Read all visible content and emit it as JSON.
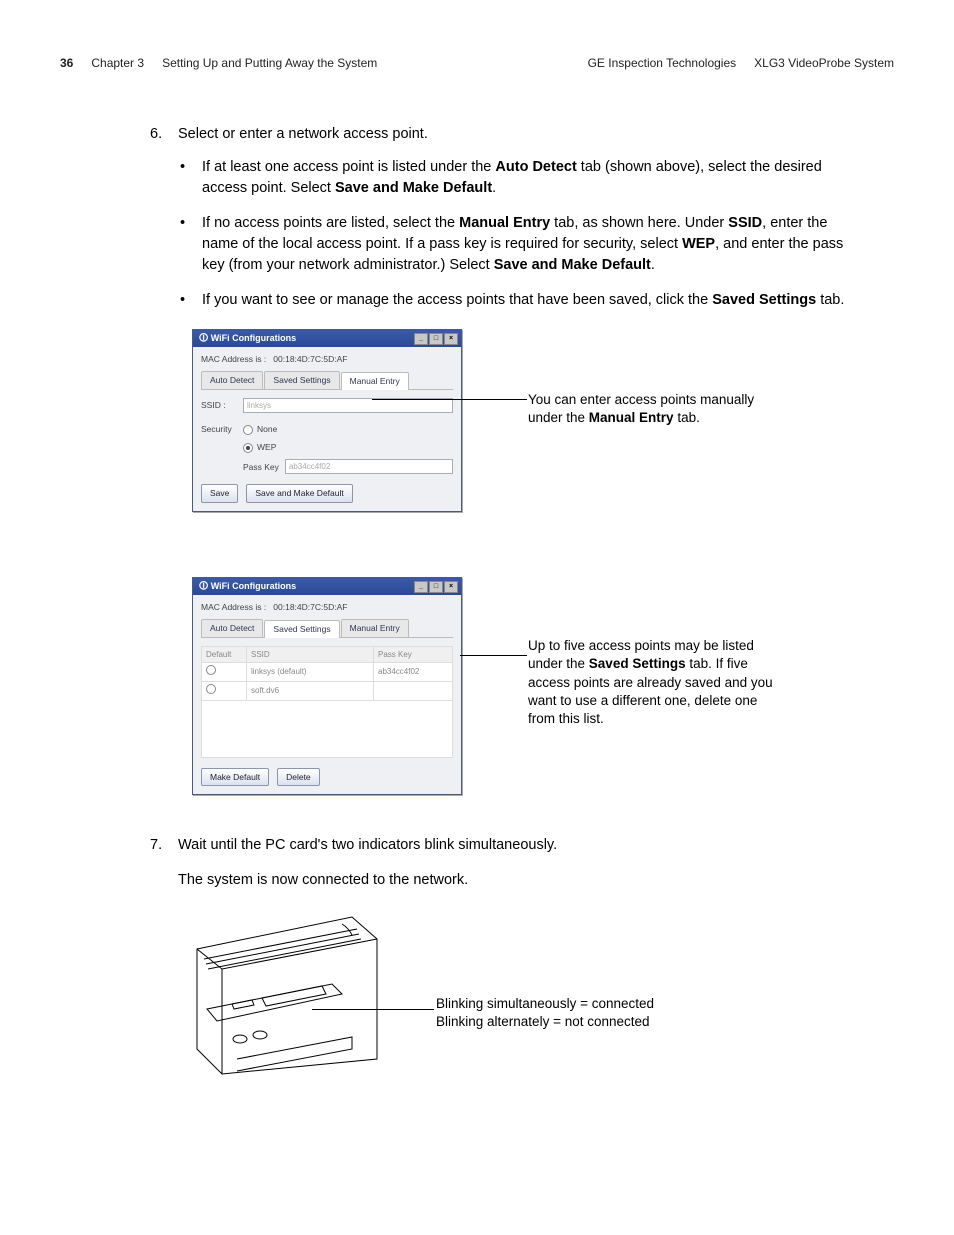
{
  "header": {
    "page_num": "36",
    "chapter": "Chapter 3",
    "chapter_title": "Setting Up and Putting Away the System",
    "company": "GE Inspection Technologies",
    "product": "XLG3 VideoProbe System"
  },
  "step6": {
    "num": "6.",
    "text": "Select or enter a network access point.",
    "b1_a": "If at least one access point is listed under the ",
    "b1_bold1": "Auto Detect",
    "b1_b": " tab (shown above), select the desired access point. Select ",
    "b1_bold2": "Save and Make Default",
    "b1_c": ".",
    "b2_a": "If no access points are listed, select the ",
    "b2_bold1": "Manual Entry",
    "b2_b": " tab, as shown here. Under ",
    "b2_bold2": "SSID",
    "b2_c": ", enter the name of the local access point. If a pass key is required for security, select ",
    "b2_bold3": "WEP",
    "b2_d": ", and enter the pass key (from your network administrator.) Select ",
    "b2_bold4": "Save and Make Default",
    "b2_e": ".",
    "b3_a": "If you want to see or manage the access points that have been saved, click the ",
    "b3_bold1": "Saved Settings",
    "b3_b": " tab."
  },
  "win1": {
    "title": "WiFi Configurations",
    "mac_label": "MAC Address is :",
    "mac_val": "00:18:4D:7C:5D:AF",
    "tab_auto": "Auto Detect",
    "tab_saved": "Saved Settings",
    "tab_manual": "Manual Entry",
    "ssid_lbl": "SSID :",
    "ssid_val": "linksys",
    "security_lbl": "Security",
    "radio_none": "None",
    "radio_wep": "WEP",
    "passkey_lbl": "Pass Key",
    "passkey_val": "ab34cc4f02",
    "btn_save": "Save",
    "btn_save_default": "Save and Make Default"
  },
  "callout1": {
    "a": "You can enter access points manually under the ",
    "bold": "Manual Entry",
    "b": " tab."
  },
  "win2": {
    "title": "WiFi Configurations",
    "mac_label": "MAC Address is :",
    "mac_val": "00:18:4D:7C:5D:AF",
    "tab_auto": "Auto Detect",
    "tab_saved": "Saved Settings",
    "tab_manual": "Manual Entry",
    "col_default": "Default",
    "col_ssid": "SSID",
    "col_passkey": "Pass Key",
    "row1_ssid": "linksys (default)",
    "row1_pk": "ab34cc4f02",
    "row2_ssid": "soft.dv6",
    "row2_pk": "",
    "btn_make_default": "Make Default",
    "btn_delete": "Delete"
  },
  "callout2": {
    "a": "Up to five access points may be listed under the ",
    "bold": "Saved Settings",
    "b": " tab. If five access points are already saved and you want to use a different one, delete one from this list."
  },
  "step7": {
    "num": "7.",
    "text": "Wait until the PC card's two indicators blink simultaneously.",
    "text2": "The system is now connected to the network."
  },
  "callout3": {
    "l1": "Blinking simultaneously = connected",
    "l2": "Blinking alternately = not connected"
  }
}
